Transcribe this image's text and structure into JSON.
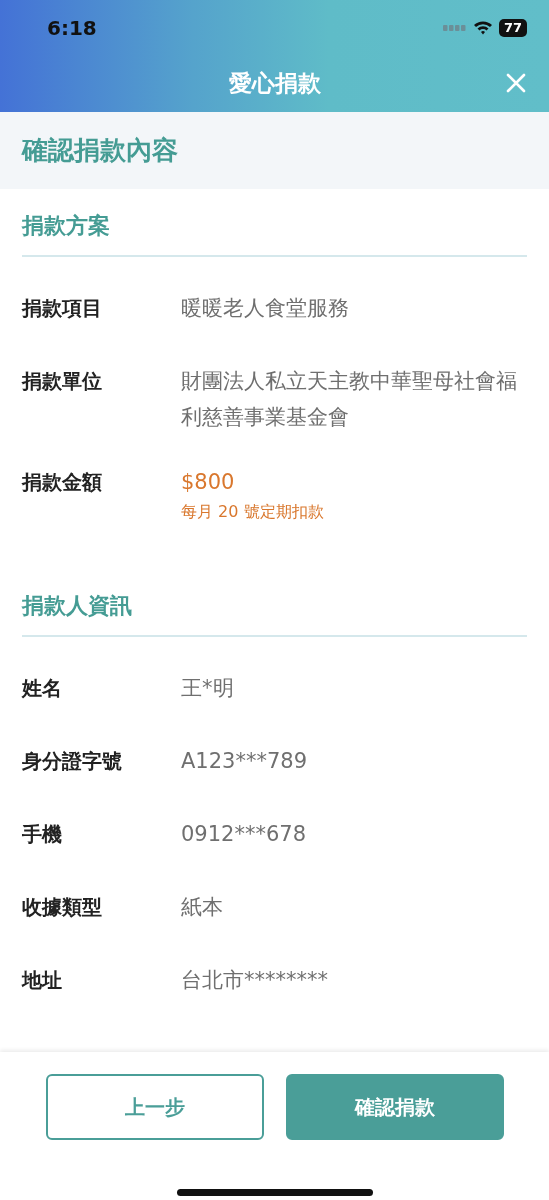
{
  "status_bar": {
    "time": "6:18",
    "battery": "77"
  },
  "header": {
    "title": "愛心捐款"
  },
  "page_title": "確認捐款內容",
  "sections": [
    {
      "title": "捐款方案",
      "rows": [
        {
          "kind": "plain",
          "label": "捐款項目",
          "value": "暖暖老人食堂服務"
        },
        {
          "kind": "plain",
          "label": "捐款單位",
          "value": "財團法人私立天主教中華聖母社會福利慈善事業基金會"
        },
        {
          "kind": "highlight",
          "label": "捐款金額",
          "value": "$800",
          "note": "每月 20 號定期扣款"
        }
      ]
    },
    {
      "title": "捐款人資訊",
      "rows": [
        {
          "kind": "plain",
          "label": "姓名",
          "value": "王*明"
        },
        {
          "kind": "plain",
          "label": "身分證字號",
          "value": "A123***789"
        },
        {
          "kind": "plain",
          "label": "手機",
          "value": "0912***678"
        },
        {
          "kind": "plain",
          "label": "收據類型",
          "value": "紙本"
        },
        {
          "kind": "plain",
          "label": "地址",
          "value": "台北市********"
        }
      ]
    }
  ],
  "buttons": [
    {
      "kind": "outline",
      "label": "上一步"
    },
    {
      "kind": "filled",
      "label": "確認捐款"
    }
  ]
}
